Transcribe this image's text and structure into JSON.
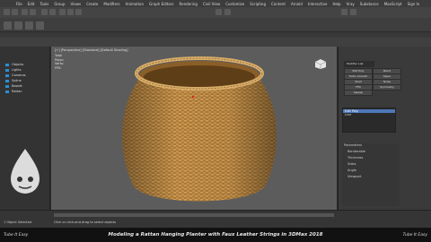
{
  "menubar": {
    "items": [
      "File",
      "Edit",
      "Tools",
      "Group",
      "Views",
      "Create",
      "Modifiers",
      "Animation",
      "Graph Editors",
      "Rendering",
      "Civil View",
      "Customize",
      "Scripting",
      "Content",
      "Arnold",
      "Interactive",
      "Help",
      "Vray",
      "Substance",
      "MaxScript",
      "Sign In"
    ]
  },
  "left_panel": {
    "scene_items": [
      "Objects",
      "Lights",
      "Cameras",
      "Spline",
      "Basket",
      "Rattan"
    ]
  },
  "viewport": {
    "label": "[+] [Perspective] [Standard] [Default Shading]",
    "stats": [
      "Total",
      "Polys:",
      "Verts:",
      "FPS:"
    ]
  },
  "right_panel": {
    "buttons": [
      "Modifier List",
      "Edit Poly",
      "Turbo Smooth",
      "Shell",
      "FFD",
      "Sweep",
      "Bend",
      "Taper",
      "Noise",
      "Symmetry"
    ],
    "stack_items": [
      "Edit Poly",
      "Line"
    ],
    "params": [
      "Parameters",
      "Renderable",
      "Thickness",
      "Sides",
      "Angle",
      "Viewport"
    ]
  },
  "statusbar": {
    "selection": "1 Object Selected",
    "hint": "Click or click-and-drag to select objects"
  },
  "caption": {
    "left_brand": "Tube It Easy",
    "title": "Modeling a Rattan Hanging Planter with Faux Leather Strings in 3DMax 2018",
    "right_brand": "Tube It Easy"
  },
  "colors": {
    "viewport_bg": "#5c5c5c",
    "rattan": "#b9843c",
    "accent": "#2a8fd6"
  }
}
